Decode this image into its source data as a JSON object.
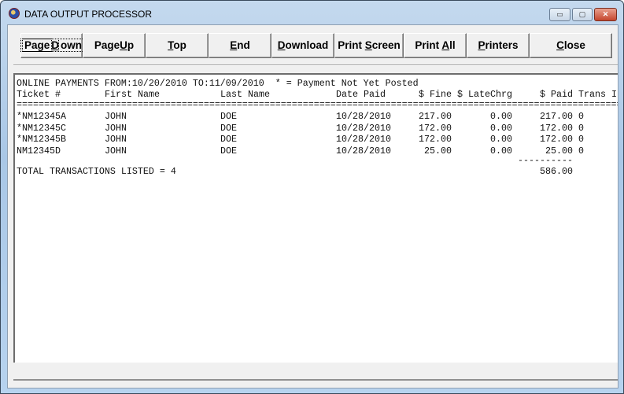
{
  "window": {
    "title": "DATA OUTPUT PROCESSOR",
    "controls": {
      "minimize": "▭",
      "maximize": "▢",
      "close": "✕"
    }
  },
  "toolbar": [
    {
      "pre": "Page",
      "u": "D",
      "post": "own"
    },
    {
      "pre": "Page",
      "u": "U",
      "post": "p"
    },
    {
      "pre": "",
      "u": "T",
      "post": "op"
    },
    {
      "pre": "",
      "u": "E",
      "post": "nd"
    },
    {
      "pre": "",
      "u": "D",
      "post": "ownload"
    },
    {
      "pre": "Print ",
      "u": "S",
      "post": "creen"
    },
    {
      "pre": "Print ",
      "u": "A",
      "post": "ll"
    },
    {
      "pre": "",
      "u": "P",
      "post": "rinters"
    },
    {
      "pre": "",
      "u": "C",
      "post": "lose"
    }
  ],
  "report": {
    "heading": "ONLINE PAYMENTS FROM:10/20/2010 TO:11/09/2010  * = Payment Not Yet Posted",
    "columns": [
      "Ticket #",
      "First Name",
      "Last Name",
      "Date Paid",
      "$ Fine",
      "$ LateChrg",
      "$ Paid",
      "Trans I"
    ],
    "rule": "===================================================================================================================",
    "rows": [
      [
        "*NM12345A",
        "JOHN",
        "DOE",
        "10/28/2010",
        "217.00",
        "0.00",
        "217.00",
        "0"
      ],
      [
        "*NM12345C",
        "JOHN",
        "DOE",
        "10/28/2010",
        "172.00",
        "0.00",
        "172.00",
        "0"
      ],
      [
        "*NM12345B",
        "JOHN",
        "DOE",
        "10/28/2010",
        "172.00",
        "0.00",
        "172.00",
        "0"
      ],
      [
        "NM12345D",
        "JOHN",
        "DOE",
        "10/28/2010",
        "25.00",
        "0.00",
        "25.00",
        "0"
      ]
    ],
    "total_rule": "----------",
    "total_label": "TOTAL TRANSACTIONS LISTED = 4",
    "total_paid": "586.00"
  }
}
